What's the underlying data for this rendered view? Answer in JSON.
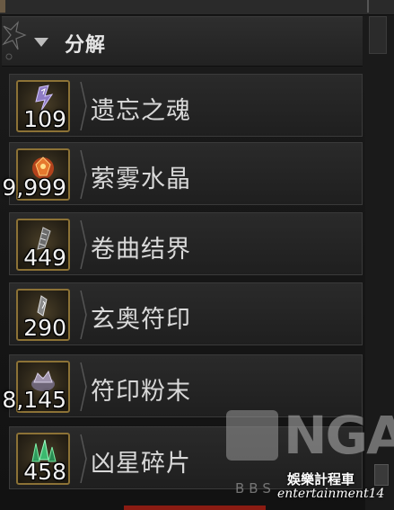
{
  "section": {
    "title": "分解"
  },
  "items": [
    {
      "name": "遗忘之魂",
      "count": "109",
      "icon": "soul-icon",
      "icon_color": "#9c8ad0"
    },
    {
      "name": "萦雾水晶",
      "count": "9,999",
      "icon": "crystal-icon",
      "icon_color": "#e0662a"
    },
    {
      "name": "卷曲结界",
      "count": "449",
      "icon": "warp-icon",
      "icon_color": "#a8a8a8"
    },
    {
      "name": "玄奥符印",
      "count": "290",
      "icon": "sigil-icon",
      "icon_color": "#c8c8c8"
    },
    {
      "name": "符印粉末",
      "count": "8,145",
      "icon": "dust-icon",
      "icon_color": "#bfb6c8"
    },
    {
      "name": "凶星碎片",
      "count": "458",
      "icon": "shard-icon",
      "icon_color": "#46c27a"
    }
  ],
  "watermark": {
    "logo_text": "NGA",
    "sub_text": "BBS",
    "credit_cn": "娛樂計程車",
    "credit_en": "entertainment14"
  }
}
